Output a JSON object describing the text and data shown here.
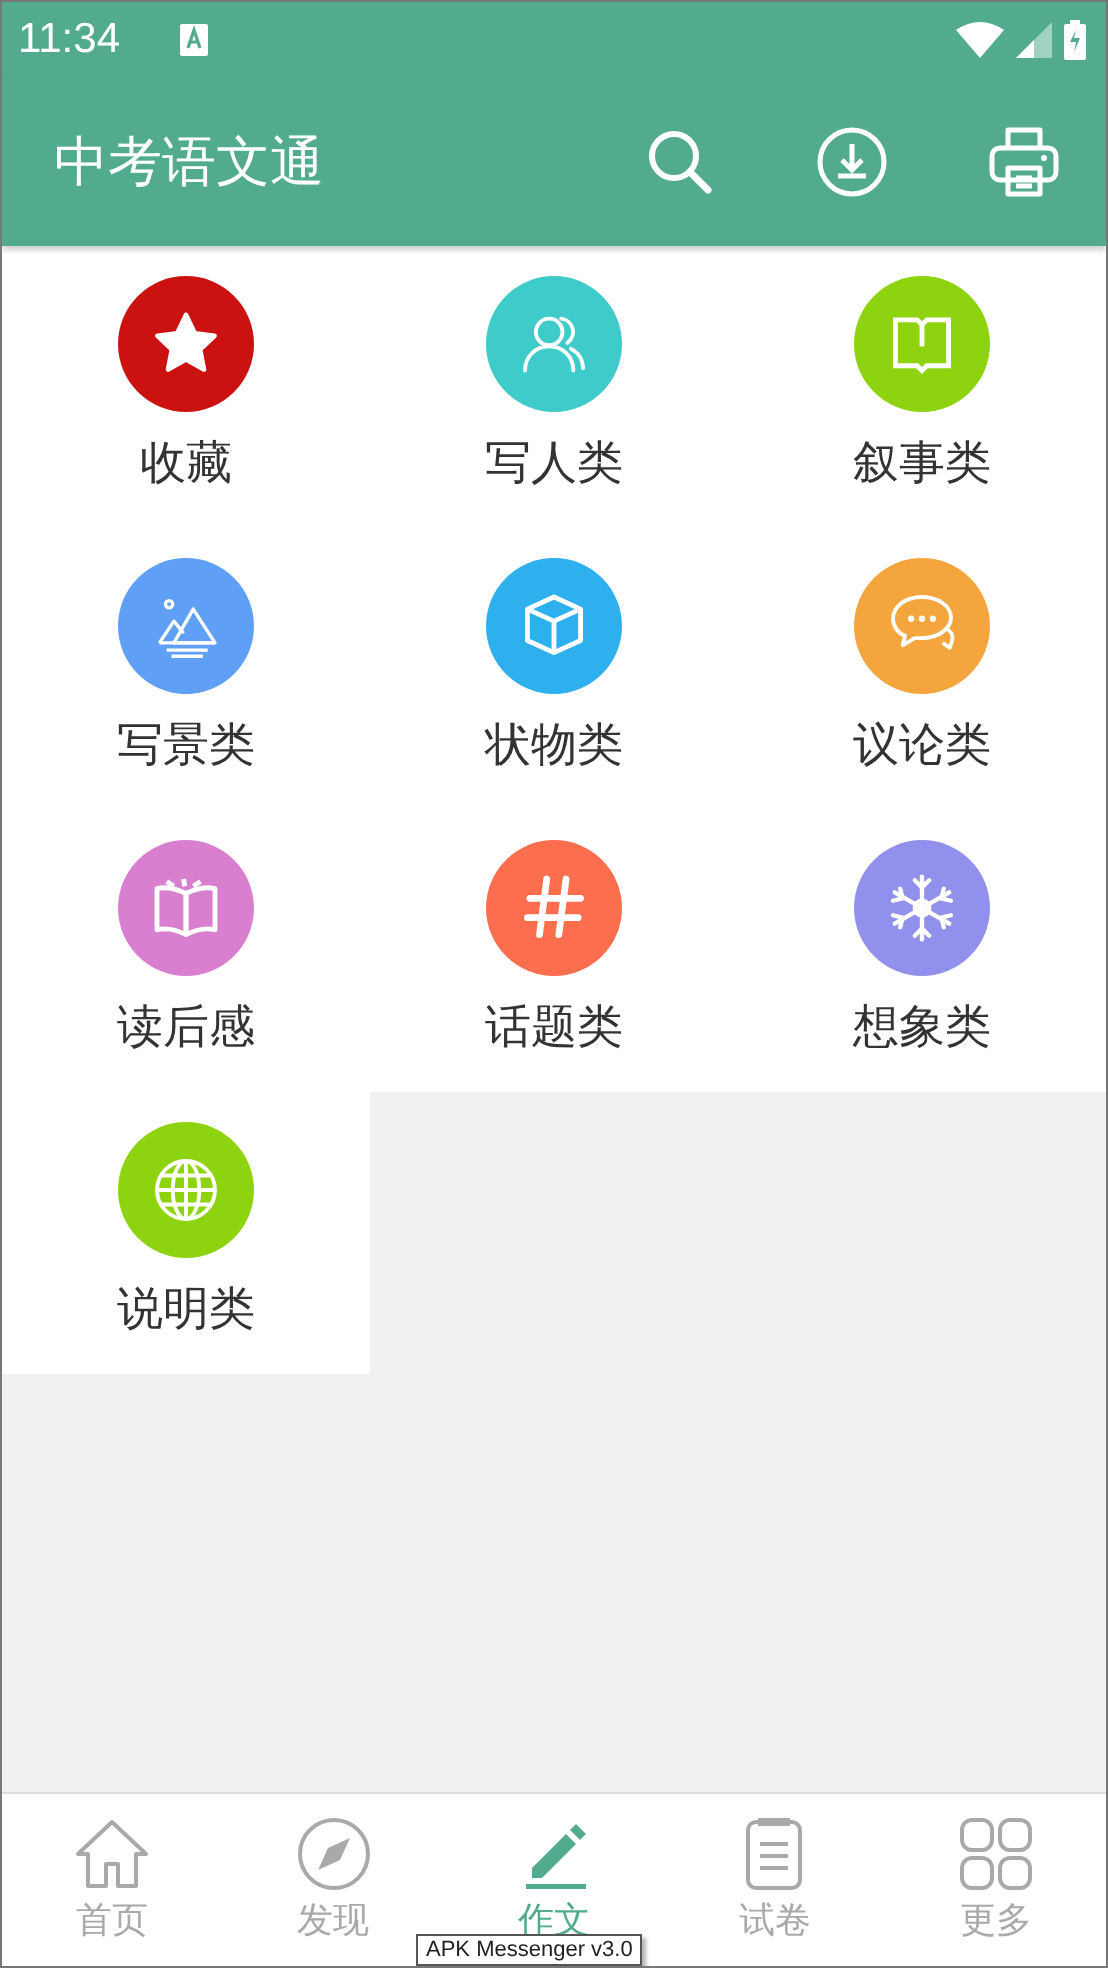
{
  "status_bar": {
    "time": "11:34"
  },
  "app_bar": {
    "title": "中考语文通"
  },
  "categories": [
    {
      "label": "收藏",
      "kind": "star",
      "color": "#cc1111"
    },
    {
      "label": "写人类",
      "kind": "people",
      "color": "#3ecbc9"
    },
    {
      "label": "叙事类",
      "kind": "book",
      "color": "#8ed30f"
    },
    {
      "label": "写景类",
      "kind": "landscape",
      "color": "#5f9ff5"
    },
    {
      "label": "状物类",
      "kind": "cube",
      "color": "#2fb0ee"
    },
    {
      "label": "议论类",
      "kind": "chat",
      "color": "#f5a53e"
    },
    {
      "label": "读后感",
      "kind": "reading",
      "color": "#d97fd0"
    },
    {
      "label": "话题类",
      "kind": "hash",
      "color": "#fc6e4d"
    },
    {
      "label": "想象类",
      "kind": "snowflake",
      "color": "#9190ec"
    },
    {
      "label": "说明类",
      "kind": "globe",
      "color": "#8ed30f"
    }
  ],
  "bottom_nav": [
    {
      "label": "首页",
      "kind": "home",
      "selected": false
    },
    {
      "label": "发现",
      "kind": "compass",
      "selected": false
    },
    {
      "label": "作文",
      "kind": "pencil",
      "selected": true
    },
    {
      "label": "试卷",
      "kind": "clipboard",
      "selected": false
    },
    {
      "label": "更多",
      "kind": "grid",
      "selected": false
    }
  ],
  "tooltip": "APK Messenger v3.0"
}
